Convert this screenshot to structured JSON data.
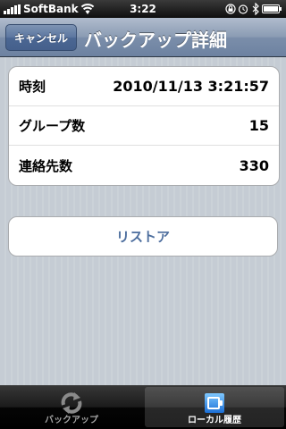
{
  "status_bar": {
    "carrier": "SoftBank",
    "time": "3:22",
    "icons": [
      "signal-icon",
      "wifi-icon",
      "rotation-lock-icon",
      "alarm-icon",
      "bluetooth-icon",
      "battery-icon"
    ]
  },
  "nav": {
    "cancel_label": "キャンセル",
    "title": "バックアップ詳細"
  },
  "details": {
    "rows": [
      {
        "label": "時刻",
        "value": "2010/11/13 3:21:57"
      },
      {
        "label": "グループ数",
        "value": "15"
      },
      {
        "label": "連絡先数",
        "value": "330"
      }
    ]
  },
  "restore_label": "リストア",
  "tabs": [
    {
      "label": "バックアップ",
      "icon": "sync-arrows-icon",
      "selected": false
    },
    {
      "label": "ローカル履歴",
      "icon": "local-history-icon",
      "selected": true
    }
  ],
  "colors": {
    "nav_bar": "#6d82a1",
    "restore_text": "#4d6e9e",
    "background": "#c5ccd4"
  }
}
